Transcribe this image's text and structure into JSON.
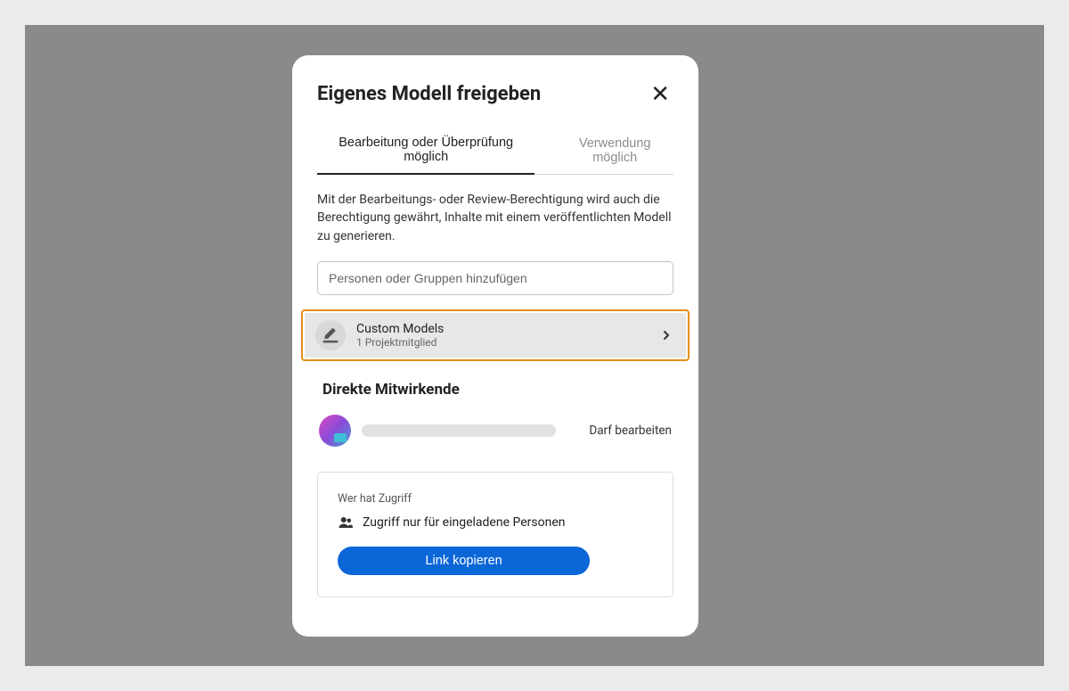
{
  "dialog": {
    "title": "Eigenes Modell freigeben"
  },
  "tabs": {
    "edit_review": "Bearbeitung oder Überprüfung möglich",
    "use": "Verwendung möglich"
  },
  "description": "Mit der Bearbeitungs- oder Review-Berechtigung wird auch die Berechtigung gewährt, Inhalte mit einem veröffentlichten Modell zu generieren.",
  "search": {
    "placeholder": "Personen oder Gruppen hinzufügen"
  },
  "group": {
    "name": "Custom Models",
    "sub": "1 Projektmitglied"
  },
  "section": {
    "direct": "Direkte Mitwirkende"
  },
  "participant": {
    "permission": "Darf bearbeiten"
  },
  "access": {
    "title": "Wer hat Zugriff",
    "text": "Zugriff nur für eingeladene Personen",
    "copy": "Link kopieren"
  }
}
